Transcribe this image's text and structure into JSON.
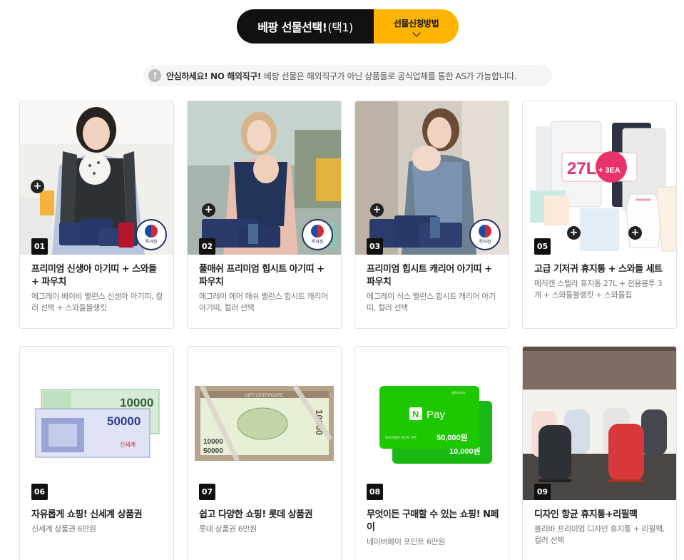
{
  "tabs": {
    "active_label": "베팡 선물선택!",
    "active_sub": "(택1)",
    "method_label": "선물신청방법"
  },
  "notice": {
    "icon": "!",
    "strong": "안심하세요! NO 해외직구!",
    "text": "베팡 선물은 해외직구가 아닌 상품들로 공식업체를 통한 AS가 가능합니다."
  },
  "products": [
    {
      "number": "01",
      "title": "프리미엄 신생아 아기띠 + 스와들 + 파우치",
      "desc": "에그레이 베이비 밸런스 신생아 아기띠, 컬러 선택 + 스와들블랭킷"
    },
    {
      "number": "02",
      "title": "풀매쉬 프리미엄 힙시트 아기띠 + 파우치",
      "desc": "에그레이 에어 매쉬 밸런스 힙시트 캐리어 아기띠, 컬러 선택"
    },
    {
      "number": "03",
      "title": "프리미엄 힙시트 캐리어 아기띠 + 파우치",
      "desc": "에그레이 식스 밸런스 힙시트 캐리어 아기띠, 컬러 선택"
    },
    {
      "number": "05",
      "title": "고급 기저귀 휴지통 + 스와들 세트",
      "desc": "매직캔 스텔라 휴지통 27L + 전용봉투 3개 + 스와들블랭킷 + 스와들집"
    },
    {
      "number": "06",
      "title": "자유롭게 쇼핑! 신세계 상품권",
      "desc": "신세계 상품권 6만원"
    },
    {
      "number": "07",
      "title": "쉽고 다양한 쇼핑! 롯데 상품권",
      "desc": "롯데 상품권 6만원"
    },
    {
      "number": "08",
      "title": "무엇이든 구매할 수 있는 쇼핑! N페이",
      "desc": "네이버페이 포인트 6만원"
    },
    {
      "number": "09",
      "title": "디자인 항균 휴지통+리필팩",
      "desc": "블리바 프리미엄 디자인 휴지통 + 리필팩, 컬러 선택"
    }
  ],
  "image_text": {
    "seal_label": "특허청",
    "trash_capacity": "27L",
    "plus_3ea": "+ 3EA",
    "ssg_10000": "10000",
    "ssg_50000": "50000",
    "ssg_brand": "신세계",
    "lotte_header": "GIFT CERTIFICATE",
    "lotte_10000": "10000",
    "lotte_50000": "50000",
    "npay_logo": "N",
    "npay_pay": "Pay",
    "npay_50000": "50,000원",
    "npay_10000": "10,000원",
    "npay_card_label": "네이버페이\n포인트 쿠폰",
    "npay_gift": "giftishow"
  },
  "colors": {
    "accent": "#ffb400",
    "dark": "#111111",
    "npay_green": "#1ec800"
  }
}
